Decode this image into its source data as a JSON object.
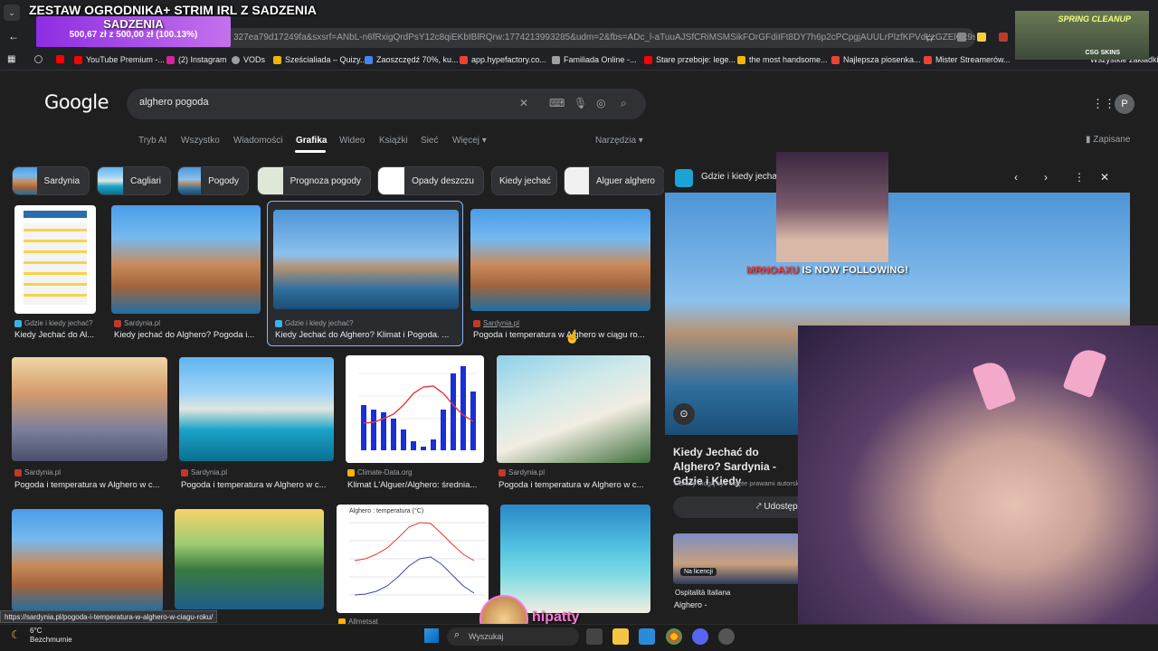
{
  "overlay": {
    "stream_title": "ZESTAW OGRODNIKA+ STRIM IRL Z SADZENIA",
    "donation_amount": "500,67 zł z 500,00 zł (100.13%)",
    "donation_progress": 1.0013,
    "follow_user": "MRNOAXU",
    "follow_text": "IS NOW FOLLOWING!",
    "chat_name": "hipatty",
    "top_cam_label1": "SPRING CLEANUP",
    "top_cam_label2": "CSG SKINS"
  },
  "browser": {
    "url_fragment": "327ea79d17249fa&sxsrf=ANbL-n6fRxigQrdPsY12c8qiEKbIBlRQrw:1774213993285&udm=2&fbs=ADc_l-aTuuAJSfCRiMSMSikFOrGFdiIFt8DY7h6p2cPCpgjAUULrPlzfKPVdLzGZElGx9s8Cb...",
    "bookmarks_right": "Wszystkie zakładki",
    "bookmarks": [
      {
        "label": "YouTube Premium -...",
        "color": "#ff0000"
      },
      {
        "label": "(2) Instagram",
        "color": "#d6249f"
      },
      {
        "label": "VODs",
        "color": "#9aa0a6"
      },
      {
        "label": "Sześcialiada – Quizy...",
        "color": "#f4b400"
      },
      {
        "label": "Zaoszczędź 70%, ku...",
        "color": "#4285f4"
      },
      {
        "label": "app.hypefactory.co...",
        "color": "#ea4335"
      },
      {
        "label": "Familiada Online -...",
        "color": "#9aa0a6"
      },
      {
        "label": "Stare przeboje: lege...",
        "color": "#ff0000"
      },
      {
        "label": "the most handsome...",
        "color": "#f4b400"
      },
      {
        "label": "Najlepsza piosenka...",
        "color": "#ea4335"
      },
      {
        "label": "Mister Streamerów...",
        "color": "#ea4335"
      }
    ],
    "status_url": "https://sardynia.pl/pogoda-i-temperatura-w-alghero-w-ciagu-roku/"
  },
  "google": {
    "logo": "Google",
    "query": "alghero pogoda",
    "tabs": [
      "Tryb AI",
      "Wszystko",
      "Wiadomości",
      "Grafika",
      "Wideo",
      "Książki",
      "Sieć",
      "Więcej"
    ],
    "active_tab": "Grafika",
    "tools": "Narzędzia",
    "saved": "Zapisane",
    "avatar_letter": "P",
    "chips": [
      "Sardynia",
      "Cagliari",
      "Pogody",
      "Prognoza pogody",
      "Opady deszczu",
      "Kiedy jechać",
      "Alguer alghero"
    ],
    "results": [
      {
        "source": "Gdzie i kiedy jechać?",
        "caption": "Kiedy Jechać do Al..."
      },
      {
        "source": "Sardynia.pl",
        "caption": "Kiedy jechać do Alghero? Pogoda i..."
      },
      {
        "source": "Gdzie i kiedy jechać?",
        "caption": "Kiedy Jechać do Alghero? Klimat i Pogoda. ..."
      },
      {
        "source": "Sardynia.pl",
        "caption": "Pogoda i temperatura w Alghero w ciągu ro..."
      },
      {
        "source": "Sardynia.pl",
        "caption": "Pogoda i temperatura w Alghero w c..."
      },
      {
        "source": "Sardynia.pl",
        "caption": "Pogoda i temperatura w Alghero w c..."
      },
      {
        "source": "Climate-Data.org",
        "caption": "Klimat L'Alguer/Alghero: średnia..."
      },
      {
        "source": "Sardynia.pl",
        "caption": "Pogoda i temperatura w Alghero w c..."
      },
      {
        "source": "Allmetsat",
        "caption": ""
      }
    ],
    "mini_chart_title": "Alghero : temperatura (°C)",
    "panel": {
      "source": "Gdzie i kiedy jechać",
      "heading": "Kiedy Jechać do Alghero? Sardynia - Gdzie i Kiedy",
      "note": "Obrazy mogą być objęte prawami autorskimi.",
      "share": "Udostępnij",
      "license": "Na licencji",
      "related_source": "Ospitalità Italiana",
      "related_caption": "Alghero -"
    }
  },
  "taskbar": {
    "temp": "6°C",
    "weather": "Bezchmurnie",
    "search": "Wyszukaj"
  }
}
